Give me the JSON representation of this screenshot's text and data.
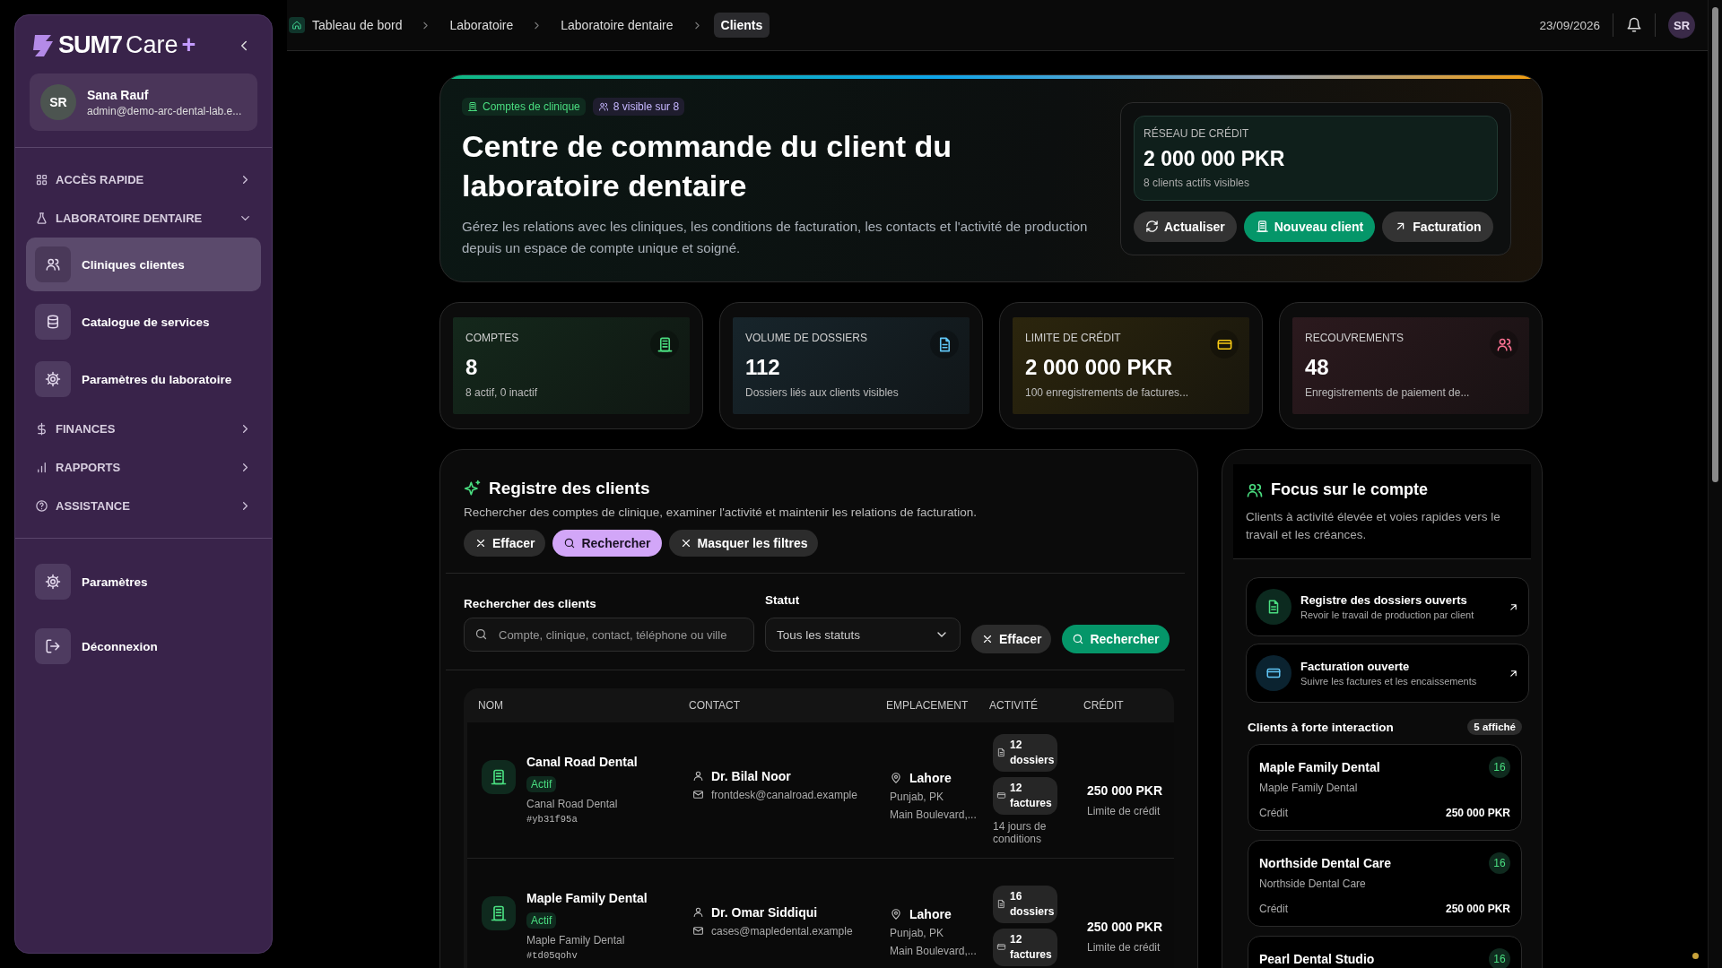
{
  "sidebar": {
    "brand": {
      "word": "SUM7",
      "product": "Care",
      "plus": "+"
    },
    "user": {
      "initials": "SR",
      "name": "Sana Rauf",
      "email": "admin@demo-arc-dental-lab.e..."
    },
    "nav": [
      {
        "label": "ACCÈS RAPIDE",
        "expanded": false
      },
      {
        "label": "LABORATOIRE DENTAIRE",
        "expanded": true,
        "children": [
          {
            "label": "Cliniques clientes",
            "selected": true
          },
          {
            "label": "Catalogue de services",
            "selected": false
          },
          {
            "label": "Paramètres du laboratoire",
            "selected": false
          }
        ]
      },
      {
        "label": "FINANCES",
        "expanded": false
      },
      {
        "label": "RAPPORTS",
        "expanded": false
      },
      {
        "label": "ASSISTANCE",
        "expanded": false
      }
    ],
    "footer": [
      {
        "label": "Paramètres"
      },
      {
        "label": "Déconnexion"
      }
    ]
  },
  "topbar": {
    "breadcrumbs": [
      {
        "label": "Tableau de bord",
        "selected": false
      },
      {
        "label": "Laboratoire",
        "selected": false
      },
      {
        "label": "Laboratoire dentaire",
        "selected": false
      },
      {
        "label": "Clients",
        "selected": true
      }
    ],
    "date": "23/09/2026",
    "avatar": "SR"
  },
  "hero": {
    "tags": [
      {
        "label": "Comptes de clinique",
        "kind": "accounts"
      },
      {
        "label": "8 visible sur 8",
        "kind": "visible"
      }
    ],
    "title": "Centre de commande du client du laboratoire dentaire",
    "description": "Gérez les relations avec les cliniques, les conditions de facturation, les contacts et l'activité de production depuis un espace de compte unique et soigné.",
    "credit": {
      "label": "RÉSEAU DE CRÉDIT",
      "value": "2 000 000 PKR",
      "note": "8 clients actifs visibles"
    },
    "buttons": [
      {
        "label": "Actualiser",
        "kind": "refresh"
      },
      {
        "label": "Nouveau client",
        "kind": "primary"
      },
      {
        "label": "Facturation",
        "kind": "link"
      }
    ]
  },
  "stats": [
    {
      "label": "COMPTES",
      "value": "8",
      "note": "8 actif, 0 inactif",
      "color": "#4ade80"
    },
    {
      "label": "VOLUME DE DOSSIERS",
      "value": "112",
      "note": "Dossiers liés aux clients visibles",
      "color": "#60c5f5"
    },
    {
      "label": "LIMITE DE CRÉDIT",
      "value": "2 000 000 PKR",
      "note": "100 enregistrements de factures...",
      "color": "#facc15"
    },
    {
      "label": "RECOUVREMENTS",
      "value": "48",
      "note": "Enregistrements de paiement de...",
      "color": "#f87191"
    }
  ],
  "registry": {
    "title": "Registre des clients",
    "description": "Rechercher des comptes de clinique, examiner l'activité et maintenir les relations de facturation.",
    "chips": [
      {
        "label": "Effacer",
        "kind": "clear"
      },
      {
        "label": "Rechercher",
        "kind": "search"
      },
      {
        "label": "Masquer les filtres",
        "kind": "hide"
      }
    ],
    "search": {
      "label": "Rechercher des clients",
      "placeholder": "Compte, clinique, contact, téléphone ou ville"
    },
    "status": {
      "label": "Statut",
      "value": "Tous les statuts"
    },
    "buttons": [
      {
        "label": "Effacer",
        "kind": "clear"
      },
      {
        "label": "Rechercher",
        "kind": "search"
      }
    ],
    "columns": [
      "NOM",
      "CONTACT",
      "EMPLACEMENT",
      "ACTIVITÉ",
      "CRÉDIT"
    ],
    "rows": [
      {
        "name": "Canal Road Dental",
        "status": "Actif",
        "clinic": "Canal Road Dental",
        "code": "#yb31f95a",
        "contact": "Dr. Bilal Noor",
        "email": "frontdesk@canalroad.example",
        "city": "Lahore",
        "region": "Punjab, PK",
        "address": "Main Boulevard,...",
        "cases": "12 dossiers",
        "invoices": "12 factures",
        "terms": "14 jours de conditions",
        "credit": "250 000 PKR",
        "credit_note": "Limite de crédit"
      },
      {
        "name": "Maple Family Dental",
        "status": "Actif",
        "clinic": "Maple Family Dental",
        "code": "#td05qohv",
        "contact": "Dr. Omar Siddiqui",
        "email": "cases@mapledental.example",
        "city": "Lahore",
        "region": "Punjab, PK",
        "address": "Main Boulevard,...",
        "cases": "16 dossiers",
        "invoices": "12 factures",
        "credit": "250 000 PKR",
        "credit_note": "Limite de crédit"
      }
    ]
  },
  "focus": {
    "title": "Focus sur le compte",
    "description": "Clients à activité élevée et voies rapides vers le travail et les créances.",
    "links": [
      {
        "title": "Registre des dossiers ouverts",
        "subtitle": "Revoir le travail de production par client"
      },
      {
        "title": "Facturation ouverte",
        "subtitle": "Suivre les factures et les encaissements"
      }
    ],
    "section": "Clients à forte interaction",
    "badge": "5 affiché",
    "clients": [
      {
        "name": "Maple Family Dental",
        "subtitle": "Maple Family Dental",
        "count": "16",
        "credit_label": "Crédit",
        "credit": "250 000 PKR"
      },
      {
        "name": "Northside Dental Care",
        "subtitle": "Northside Dental Care",
        "count": "16",
        "credit_label": "Crédit",
        "credit": "250 000 PKR"
      },
      {
        "name": "Pearl Dental Studio",
        "count": "16"
      }
    ]
  }
}
